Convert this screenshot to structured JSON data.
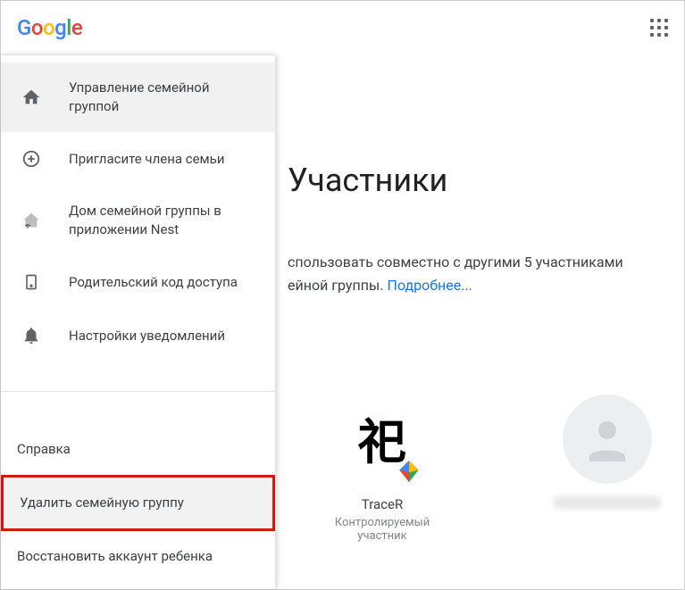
{
  "header": {
    "logo_letters": [
      "G",
      "o",
      "o",
      "g",
      "l",
      "e"
    ]
  },
  "sidebar": {
    "items": [
      {
        "label": "Управление семейной группой"
      },
      {
        "label": "Пригласите члена семьи"
      },
      {
        "label": "Дом семейной группы в приложении Nest"
      },
      {
        "label": "Родительский код доступа"
      },
      {
        "label": "Настройки уведомлений"
      }
    ],
    "bottom": [
      {
        "label": "Справка"
      },
      {
        "label": "Удалить семейную группу"
      },
      {
        "label": "Восстановить аккаунт ребенка"
      }
    ]
  },
  "main": {
    "title": "Участники",
    "desc_prefix": "спользовать совместно с другими 5 участниками ейной группы. ",
    "desc_link": "Подробнее...",
    "members": [
      {
        "name": "TraceR",
        "role": "Контролируемый участник"
      },
      {
        "name": "",
        "role": ""
      }
    ]
  }
}
